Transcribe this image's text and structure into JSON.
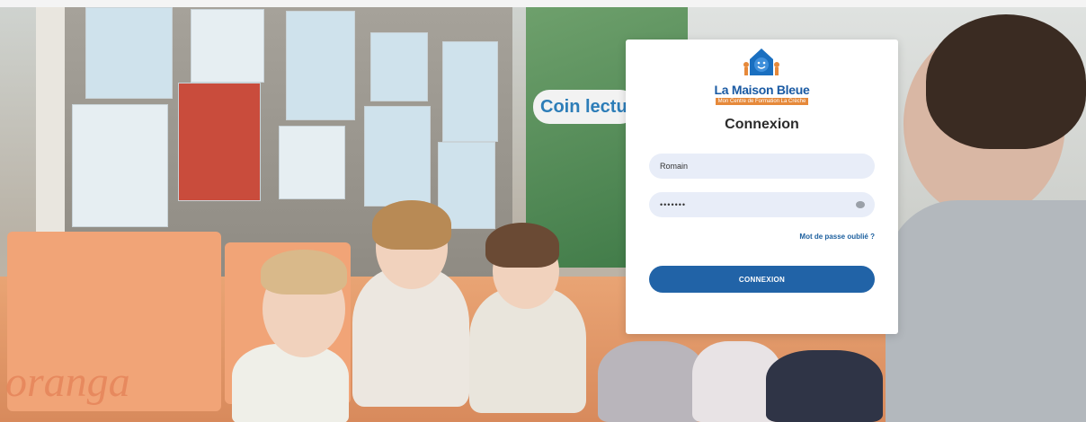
{
  "background": {
    "sign_text": "Coin lectu",
    "cushion_text": "oranga"
  },
  "login": {
    "logo": {
      "name": "La Maison Bleue",
      "tagline": "Mon Centre de Formation La Crèche"
    },
    "title": "Connexion",
    "username_value": "Romain",
    "password_value": "•••••••",
    "forgot_password": "Mot de passe oublié ?",
    "submit_label": "CONNEXION"
  },
  "colors": {
    "brand_blue": "#2163a7",
    "brand_orange": "#e6893a",
    "field_bg": "#e8edf8"
  }
}
